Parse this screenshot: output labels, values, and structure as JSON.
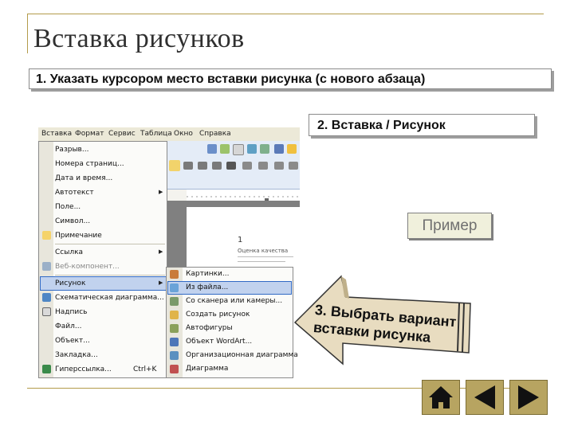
{
  "slide": {
    "title": "Вставка рисунков",
    "step1": "1. Указать курсором место вставки рисунка (с нового абзаца)",
    "step2": "2. Вставка / Рисунок",
    "step3_line1": "3. Выбрать вариант",
    "step3_line2": "вставки рисунка",
    "example_button": "Пример"
  },
  "screenshot": {
    "menubar": [
      "Вставка",
      "Формат",
      "Сервис",
      "Таблица",
      "Окно",
      "Справка"
    ],
    "insert_menu": [
      {
        "label": "Разрыв...",
        "icon": "none"
      },
      {
        "label": "Номера страниц...",
        "icon": "none"
      },
      {
        "label": "Дата и время...",
        "icon": "none"
      },
      {
        "label": "Автотекст",
        "icon": "none",
        "submenu": true
      },
      {
        "label": "Поле...",
        "icon": "none"
      },
      {
        "label": "Символ...",
        "icon": "none"
      },
      {
        "label": "Примечание",
        "icon": "note-icon"
      },
      {
        "label": "Ссылка",
        "icon": "none",
        "submenu": true
      },
      {
        "label": "Веб-компонент...",
        "icon": "web-component-icon"
      },
      {
        "label": "Рисунок",
        "icon": "none",
        "submenu": true,
        "highlighted": true
      },
      {
        "label": "Схематическая диаграмма...",
        "icon": "diagram-icon"
      },
      {
        "label": "Надпись",
        "icon": "textbox-icon"
      },
      {
        "label": "Файл...",
        "icon": "none"
      },
      {
        "label": "Объект...",
        "icon": "none"
      },
      {
        "label": "Закладка...",
        "icon": "none"
      },
      {
        "label": "Гиперссылка...",
        "icon": "hyperlink-icon",
        "shortcut": "Ctrl+K"
      }
    ],
    "picture_submenu": [
      {
        "label": "Картинки...",
        "icon": "clipart-icon"
      },
      {
        "label": "Из файла...",
        "icon": "from-file-icon",
        "highlighted": true
      },
      {
        "label": "Со сканера или камеры...",
        "icon": "scanner-icon"
      },
      {
        "label": "Создать рисунок",
        "icon": "new-drawing-icon"
      },
      {
        "label": "Автофигуры",
        "icon": "autoshapes-icon"
      },
      {
        "label": "Объект WordArt...",
        "icon": "wordart-icon"
      },
      {
        "label": "Организационная диаграмма",
        "icon": "org-chart-icon"
      },
      {
        "label": "Диаграмма",
        "icon": "chart-icon"
      }
    ],
    "document": {
      "page_number": "1",
      "text_preview": "Оценка качества"
    }
  },
  "navigation": {
    "home": "home-icon",
    "prev": "prev-arrow-icon",
    "next": "next-arrow-icon"
  },
  "colors": {
    "frame": "#b39b4a",
    "nav_button": "#b7a461",
    "menu_highlight": "#c1d2ee"
  }
}
